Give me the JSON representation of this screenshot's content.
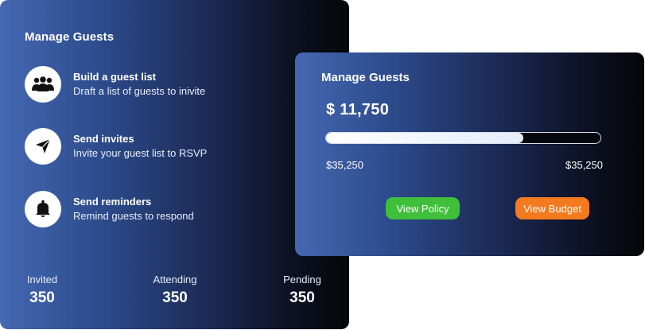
{
  "guests_card": {
    "title": "Manage Guests",
    "steps": [
      {
        "icon": "people-icon",
        "title": "Build a guest list",
        "description": "Draft a list of guests to inivite"
      },
      {
        "icon": "paper-plane-icon",
        "title": "Send invites",
        "description": "Invite your guest list to RSVP"
      },
      {
        "icon": "bell-icon",
        "title": "Send reminders",
        "description": "Remind guests to respond"
      }
    ],
    "stats": [
      {
        "label": "Invited",
        "value": "350"
      },
      {
        "label": "Attending",
        "value": "350"
      },
      {
        "label": "Pending",
        "value": "350"
      }
    ]
  },
  "budget_card": {
    "title": "Manage Guests",
    "amount": "$ 11,750",
    "progress_percent": 72,
    "range_min_label": "$35,250",
    "range_max_label": "$35,250",
    "buttons": {
      "policy_label": "View Policy",
      "budget_label": "View Budget"
    }
  },
  "colors": {
    "card_gradient_start": "#4568b3",
    "card_gradient_end": "#050608",
    "policy_button": "#3fbf3a",
    "budget_button": "#f47a1f"
  }
}
